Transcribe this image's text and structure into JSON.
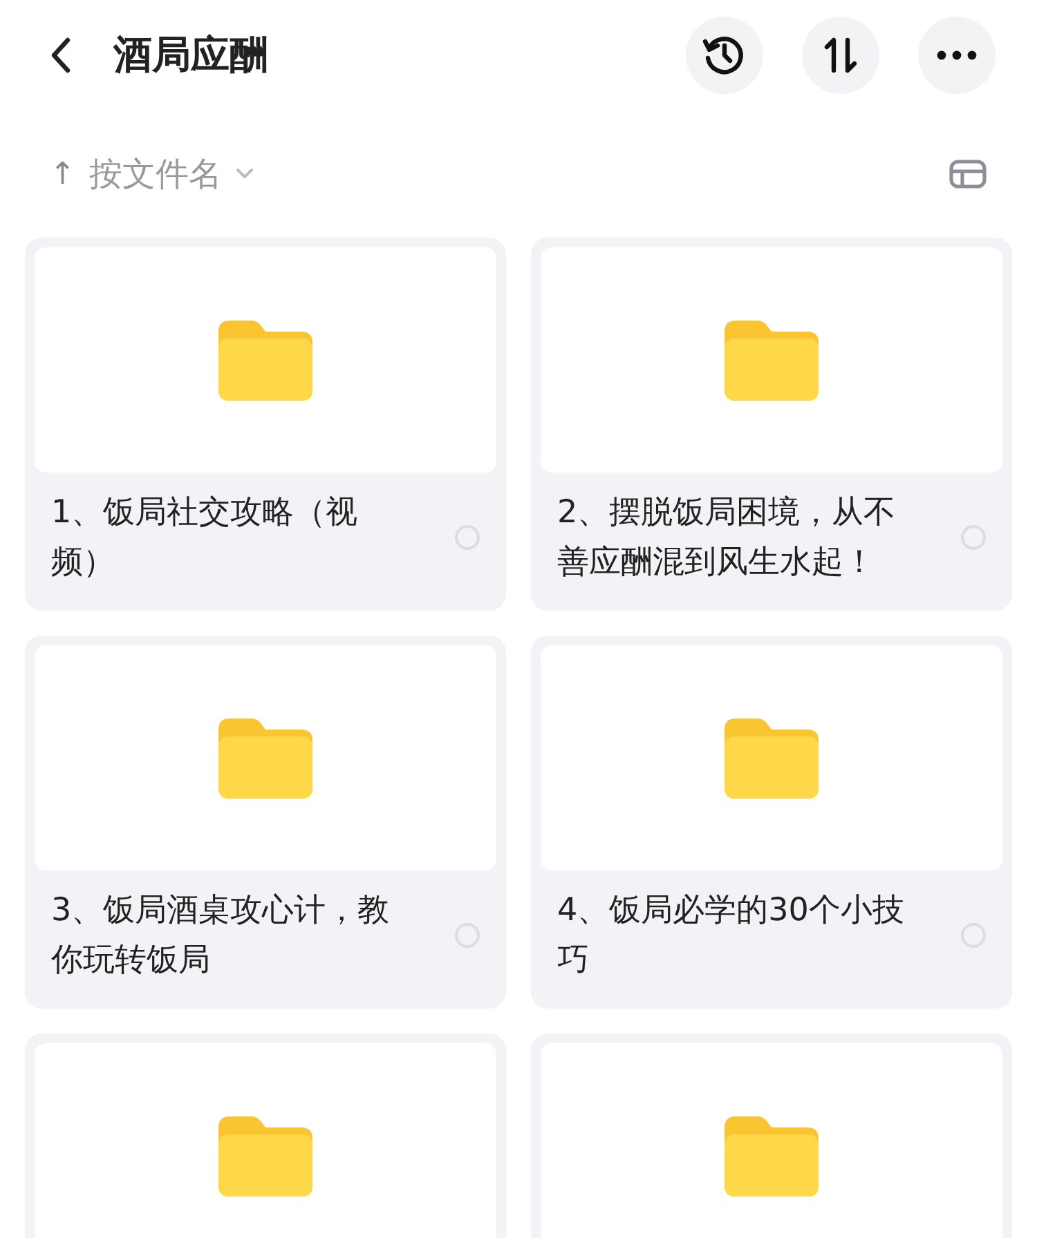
{
  "header": {
    "title": "酒局应酬"
  },
  "sort": {
    "arrow": "↑",
    "label": "按文件名"
  },
  "folders": [
    {
      "kind": "folder",
      "title": "1、饭局社交攻略（视频）",
      "selected": false
    },
    {
      "kind": "folder",
      "title": "2、摆脱饭局困境，从不善应酬混到风生水起！",
      "selected": false
    },
    {
      "kind": "folder",
      "title": "3、饭局酒桌攻心计，教你玩转饭局",
      "selected": false
    },
    {
      "kind": "folder",
      "title": "4、饭局必学的30个小技巧",
      "selected": false
    },
    {
      "kind": "folder"
    },
    {
      "kind": "folder"
    }
  ]
}
